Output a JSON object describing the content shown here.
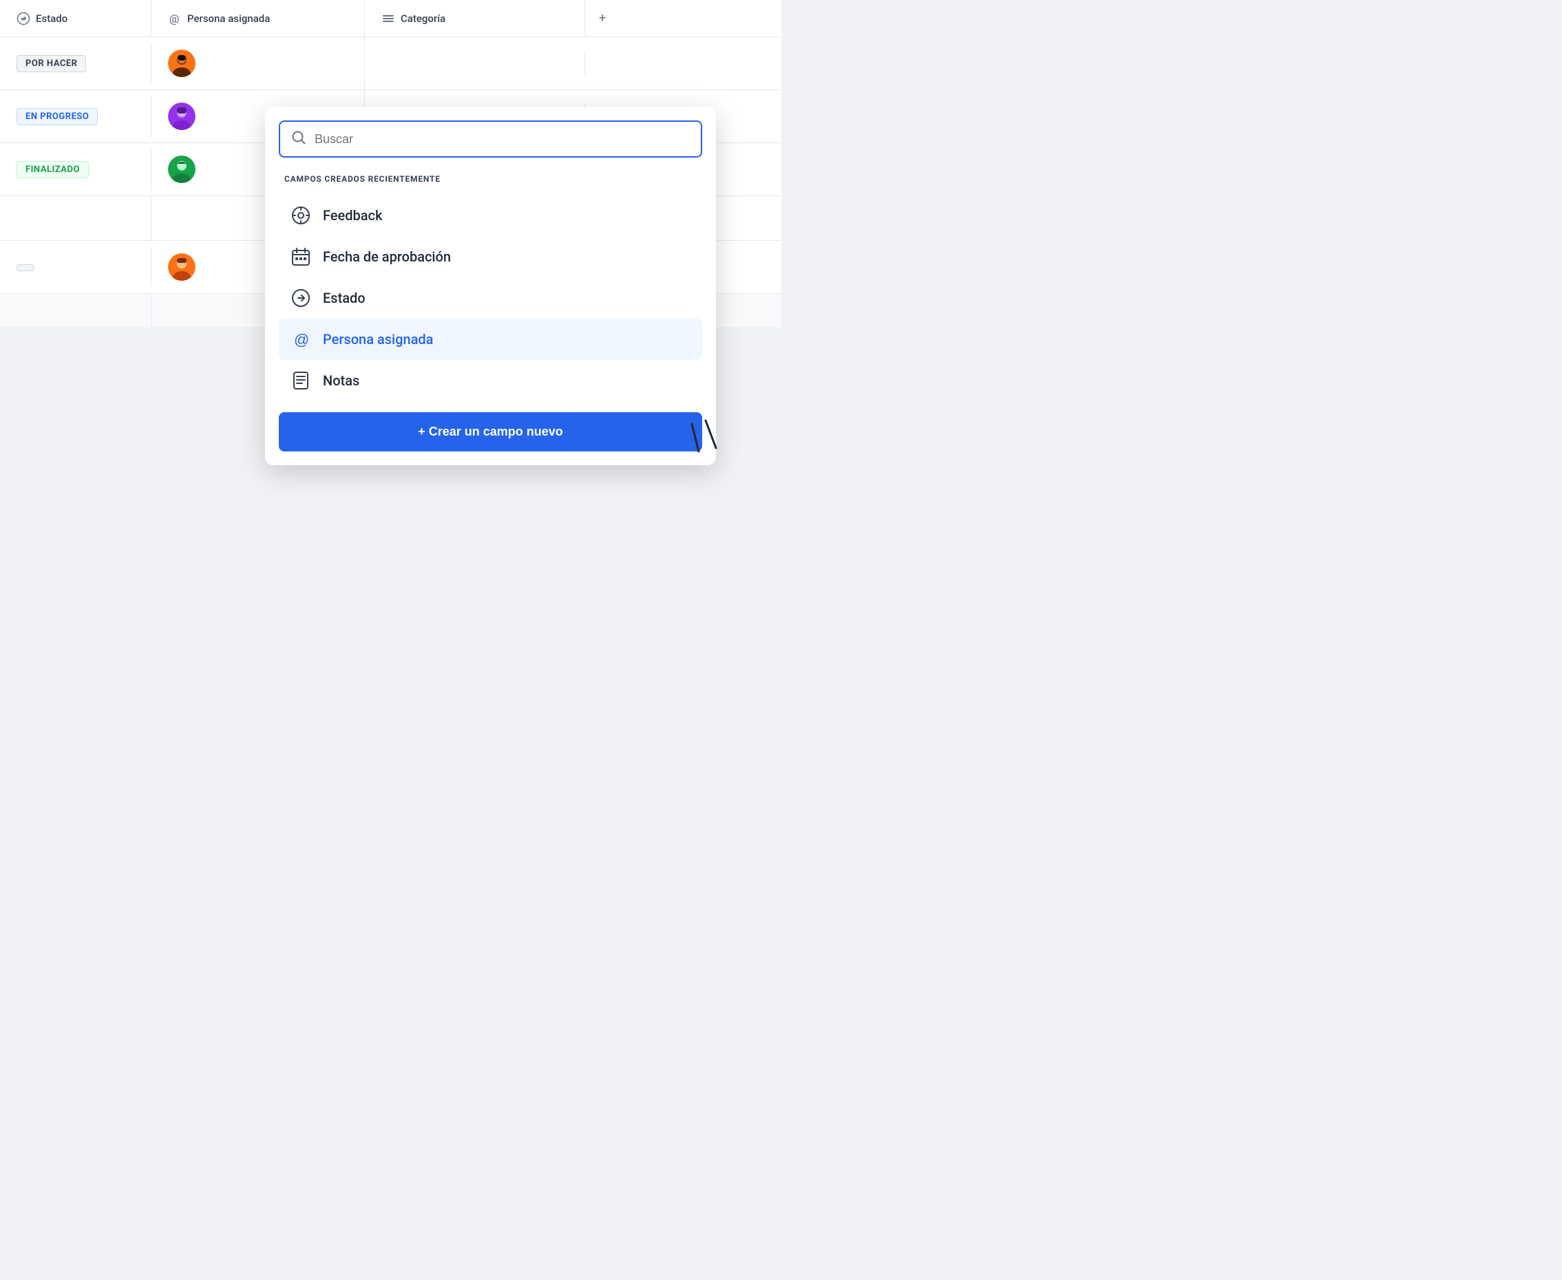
{
  "colors": {
    "orange": "#F59E0B",
    "blue": "#2563eb",
    "green": "#16a34a",
    "purple": "#9333ea"
  },
  "table": {
    "columns": [
      {
        "id": "estado",
        "label": "Estado",
        "icon": "arrow-right-circle"
      },
      {
        "id": "persona",
        "label": "Persona asignada",
        "icon": "at-sign"
      },
      {
        "id": "categoria",
        "label": "Categoría",
        "icon": "menu-lines"
      },
      {
        "id": "add",
        "label": "+"
      }
    ],
    "rows": [
      {
        "estado": "POR HACER",
        "estado_type": "por-hacer",
        "avatar_color": "orange"
      },
      {
        "estado": "EN PROGRESO",
        "estado_type": "en-progreso",
        "avatar_color": "purple"
      },
      {
        "estado": "FINALIZADO",
        "estado_type": "finalizado",
        "avatar_color": "green"
      },
      {
        "estado": "",
        "estado_type": "empty",
        "avatar_color": "orange2"
      }
    ]
  },
  "dropdown": {
    "search_placeholder": "Buscar",
    "section_title": "CAMPOS CREADOS RECIENTEMENTE",
    "fields": [
      {
        "id": "feedback",
        "label": "Feedback",
        "icon": "chat-icon",
        "highlighted": false
      },
      {
        "id": "fecha",
        "label": "Fecha de aprobación",
        "icon": "calendar-icon",
        "highlighted": false
      },
      {
        "id": "estado",
        "label": "Estado",
        "icon": "arrow-circle-icon",
        "highlighted": false
      },
      {
        "id": "persona",
        "label": "Persona asignada",
        "icon": "at-icon",
        "highlighted": true
      },
      {
        "id": "notas",
        "label": "Notas",
        "icon": "notes-icon",
        "highlighted": false
      }
    ],
    "create_button": "+ Crear un campo nuevo"
  }
}
